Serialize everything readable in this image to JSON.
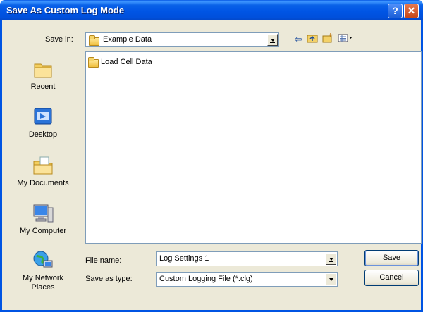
{
  "window": {
    "title": "Save As Custom Log Mode"
  },
  "toolbar": {
    "save_in_label": "Save in:",
    "save_in_value": "Example Data",
    "back_icon": "back-arrow-icon",
    "up_icon": "up-folder-icon",
    "new_folder_icon": "new-folder-icon",
    "views_icon": "views-menu-icon"
  },
  "places": [
    {
      "label": "Recent",
      "icon": "recent-folder-icon"
    },
    {
      "label": "Desktop",
      "icon": "desktop-icon"
    },
    {
      "label": "My Documents",
      "icon": "my-documents-icon"
    },
    {
      "label": "My Computer",
      "icon": "my-computer-icon"
    },
    {
      "label": "My Network\nPlaces",
      "icon": "network-places-icon"
    }
  ],
  "file_list": {
    "items": [
      {
        "name": "Load Cell Data",
        "type": "folder"
      }
    ]
  },
  "form": {
    "file_name_label": "File name:",
    "file_name_value": "Log Settings 1",
    "save_as_type_label": "Save as type:",
    "save_as_type_value": "Custom Logging File (*.clg)"
  },
  "buttons": {
    "save": "Save",
    "cancel": "Cancel"
  },
  "colors": {
    "titlebar": "#0055e5",
    "dialog_bg": "#ece9d8",
    "field_border": "#7f9db9"
  }
}
